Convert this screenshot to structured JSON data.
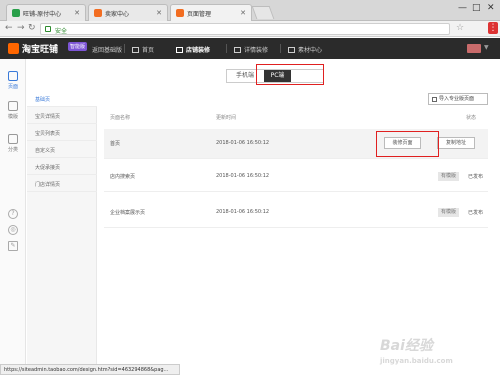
{
  "browser": {
    "tabs": [
      {
        "label": "旺铺-原付中心",
        "color": "#2aa04a"
      },
      {
        "label": "卖家中心",
        "color": "#f26d21"
      },
      {
        "label": "页面管理",
        "color": "#f26d21"
      }
    ],
    "secure_label": "安全",
    "window_controls": [
      "—",
      "□",
      "✕"
    ]
  },
  "topnav": {
    "logo": "淘宝旺铺",
    "badge": "智能版",
    "items": [
      "返回基础版",
      "首页",
      "店铺装修",
      "详情装修",
      "素材中心"
    ]
  },
  "rail": {
    "items": [
      "页面",
      "模版",
      "分类"
    ],
    "help": [
      "?",
      "◎",
      "✎"
    ]
  },
  "switch": {
    "mobile": "手机端",
    "pc": "PC端"
  },
  "pagenav": {
    "items": [
      "基础页",
      "宝贝详情页",
      "宝贝列表页",
      "自定义页",
      "大促承接页",
      "门店详情页"
    ]
  },
  "toolbar": {
    "import_label": "导入专业版页面"
  },
  "table": {
    "headers": [
      "页面名称",
      "更新时间",
      "状态"
    ],
    "rows": [
      {
        "name": "首页",
        "time": "2018-01-06 16:50:12",
        "actions": [
          "装修页面",
          "复制地址"
        ]
      },
      {
        "name": "店内搜索页",
        "time": "2018-01-06 16:50:12",
        "tag": "有模版",
        "status": "已发布"
      },
      {
        "name": "企业档案展示页",
        "time": "2018-01-06 16:50:12",
        "tag": "有模版",
        "status": "已发布"
      }
    ]
  },
  "statusbar": {
    "url": "https://siteadmin.taobao.com/design.htm?sid=463294868&pag..."
  },
  "watermark": {
    "title": "Bai经验",
    "sub": "jingyan.baidu.com"
  },
  "colors": {
    "accent": "#3a7ad9",
    "highlight_box": "#e02020",
    "nav_bg": "#2b2b2b"
  }
}
